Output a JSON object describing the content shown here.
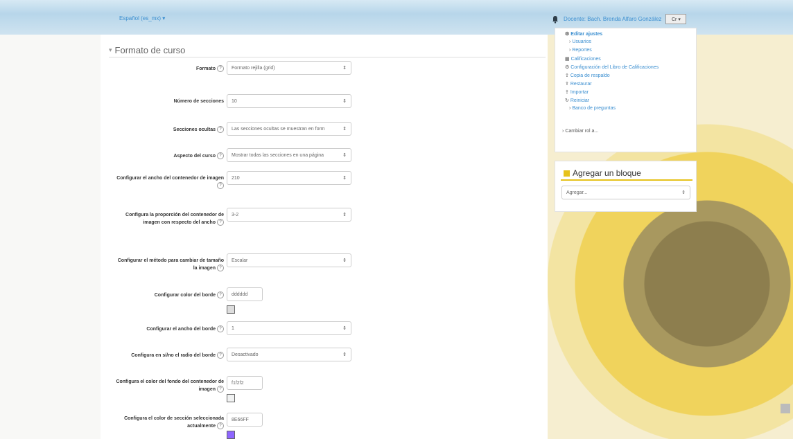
{
  "topbar": {
    "language": "Español (es_mx) ▾",
    "user": "Docente: Bach. Brenda Alfaro González",
    "avatar_text": "Cr ▾"
  },
  "section": {
    "title": "Formato de curso"
  },
  "fields": {
    "formato": {
      "label": "Formato",
      "value": "Formato rejilla (grid)"
    },
    "num_secciones": {
      "label": "Número de secciones",
      "value": "10"
    },
    "secciones_ocultas": {
      "label": "Secciones ocultas",
      "value": "Las secciones ocultas se muestran en form"
    },
    "aspecto": {
      "label": "Aspecto del curso",
      "value": "Mostrar todas las secciones en una página"
    },
    "ancho_contenedor": {
      "label": "Configurar el ancho del contenedor de imagen",
      "value": "210"
    },
    "proporcion": {
      "label": "Configura la proporción del contenedor de imagen con respecto del ancho",
      "value": "3-2"
    },
    "metodo": {
      "label": "Configurar el método para cambiar de tamaño la imagen",
      "value": "Escalar"
    },
    "color_borde": {
      "label": "Configurar color del borde",
      "value": "dddddd",
      "swatch": "#dddddd"
    },
    "ancho_borde": {
      "label": "Configurar el ancho del borde",
      "value": "1"
    },
    "radio_borde": {
      "label": "Configura en sí/no el radio del borde",
      "value": "Desactivado"
    },
    "color_fondo": {
      "label": "Configura el color del fondo del contenedor de imagen",
      "value": "f1f2f2",
      "swatch": "#f1f2f2"
    },
    "color_seccion": {
      "label": "Configura el color de sección seleccionada actualmente",
      "value": "8E66FF",
      "swatch": "#8e66ff"
    }
  },
  "admin": {
    "items": [
      {
        "label": "Editar ajustes",
        "icon": "gear-icon",
        "glyph": "⚙"
      },
      {
        "label": "Usuarios",
        "icon": "chevron-right-icon",
        "glyph": "›"
      },
      {
        "label": "Reportes",
        "icon": "chevron-right-icon",
        "glyph": "›"
      },
      {
        "label": "Calificaciones",
        "icon": "table-icon",
        "glyph": "▦"
      },
      {
        "label": "Configuración del Libro de Calificaciones",
        "icon": "gear-icon",
        "glyph": "⚙"
      },
      {
        "label": "Copia de respaldo",
        "icon": "upload-icon",
        "glyph": "⇪"
      },
      {
        "label": "Restaurar",
        "icon": "upload-icon",
        "glyph": "⇪"
      },
      {
        "label": "Importar",
        "icon": "upload-icon",
        "glyph": "⇪"
      },
      {
        "label": "Reiniciar",
        "icon": "refresh-icon",
        "glyph": "↻"
      },
      {
        "label": "Banco de preguntas",
        "icon": "chevron-right-icon",
        "glyph": "›"
      }
    ],
    "switch_role": {
      "label": "Cambiar rol a...",
      "glyph": "›"
    }
  },
  "add_block": {
    "title": "Agregar un bloque",
    "select_value": "Agregar..."
  },
  "ui": {
    "select_arrow": "⇕",
    "help_glyph": "?"
  }
}
